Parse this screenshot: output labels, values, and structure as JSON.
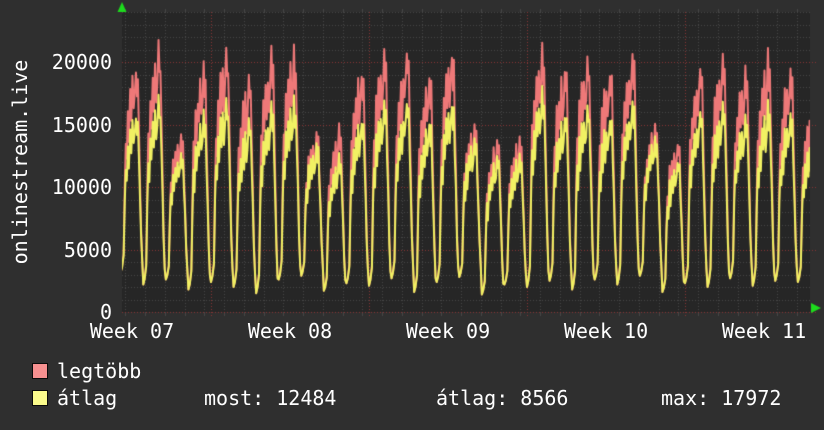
{
  "colors": {
    "page_bg": "#2f2f2f",
    "plot_bg": "#262626",
    "grid_minor": "#474747",
    "grid_major": "#8a3535",
    "axis_arrow": "#1ddb1d",
    "series_legtobb": "#ee7878",
    "series_atlag": "#f1f163",
    "swatch_legtobb": "#f79090",
    "swatch_atlag": "#fbfb8b",
    "text": "#ffffff"
  },
  "legend": {
    "items": [
      {
        "label": "legtöbb"
      },
      {
        "label": "átlag"
      }
    ],
    "stats": [
      {
        "label": "most:",
        "value": "12484",
        "text": "most: 12484"
      },
      {
        "label": "átlag:",
        "value": "8566",
        "text": "átlag: 8566"
      },
      {
        "label": "max:",
        "value": "17972",
        "text": "max: 17972"
      }
    ]
  },
  "chart_data": {
    "type": "line",
    "title": "onlinestream.live",
    "y_axis_title": "onlinestream.live",
    "x_tick_labels": [
      "Week 07",
      "Week 08",
      "Week 09",
      "Week 10",
      "Week 11"
    ],
    "y_tick_labels": [
      "0",
      "5000",
      "10000",
      "15000",
      "20000"
    ],
    "y_ticks": [
      0,
      5000,
      10000,
      15000,
      20000
    ],
    "y_max": 24000,
    "grid": {
      "minor_step_y": 1000,
      "major_step_y": 5000,
      "minor_x_per_week": 8,
      "weeks_shown": 5,
      "style": "dotted"
    },
    "legend_position": "bottom-left",
    "series": [
      {
        "name": "legtöbb",
        "meaning": "daily maximum listeners",
        "color": "#ee7878"
      },
      {
        "name": "átlag",
        "meaning": "daily average listeners",
        "color": "#f1f163"
      }
    ],
    "stats": {
      "most": 12484,
      "atlag": 8566,
      "max": 17972
    },
    "day_keys": [
      "legtobb_peak",
      "atlag_peak",
      "night_valley"
    ],
    "days": [
      [
        19800,
        16000,
        3200
      ],
      [
        20900,
        16800,
        2200
      ],
      [
        14600,
        13000,
        2600
      ],
      [
        19600,
        15800,
        1800
      ],
      [
        21000,
        17000,
        2400
      ],
      [
        18600,
        15200,
        2000
      ],
      [
        20800,
        16500,
        1500
      ],
      [
        20900,
        17000,
        2600
      ],
      [
        14400,
        13500,
        2900
      ],
      [
        14500,
        12300,
        1700
      ],
      [
        19500,
        15600,
        2300
      ],
      [
        20500,
        16600,
        2100
      ],
      [
        20700,
        16700,
        2700
      ],
      [
        19000,
        15300,
        1600
      ],
      [
        20800,
        16800,
        2400
      ],
      [
        15000,
        13900,
        2800
      ],
      [
        13700,
        12400,
        1400
      ],
      [
        14200,
        12800,
        2200
      ],
      [
        21400,
        17972,
        2000
      ],
      [
        19800,
        16000,
        2500
      ],
      [
        20300,
        16500,
        1800
      ],
      [
        19400,
        15700,
        2600
      ],
      [
        20800,
        16900,
        2200
      ],
      [
        15000,
        14000,
        2900
      ],
      [
        13800,
        12300,
        1600
      ],
      [
        19800,
        16200,
        2300
      ],
      [
        20400,
        16600,
        2000
      ],
      [
        19600,
        15800,
        2700
      ],
      [
        20300,
        16400,
        2100
      ],
      [
        19500,
        15900,
        2500
      ],
      [
        16400,
        14000,
        2400
      ]
    ],
    "day_profile": [
      [
        0.0,
        0.0
      ],
      [
        0.06,
        0.03
      ],
      [
        0.13,
        0.1
      ],
      [
        0.18,
        0.45
      ],
      [
        0.225,
        0.66
      ],
      [
        0.27,
        0.56
      ],
      [
        0.315,
        0.8
      ],
      [
        0.36,
        0.66
      ],
      [
        0.42,
        0.88
      ],
      [
        0.47,
        0.74
      ],
      [
        0.52,
        0.92
      ],
      [
        0.575,
        0.78
      ],
      [
        0.625,
        0.86
      ],
      [
        0.675,
        1.0
      ],
      [
        0.72,
        0.88
      ],
      [
        0.76,
        0.94
      ],
      [
        0.8,
        0.72
      ],
      [
        0.85,
        0.5
      ],
      [
        0.9,
        0.24
      ],
      [
        0.95,
        0.08
      ],
      [
        1.0,
        0.0
      ]
    ],
    "render_seed": 9
  }
}
